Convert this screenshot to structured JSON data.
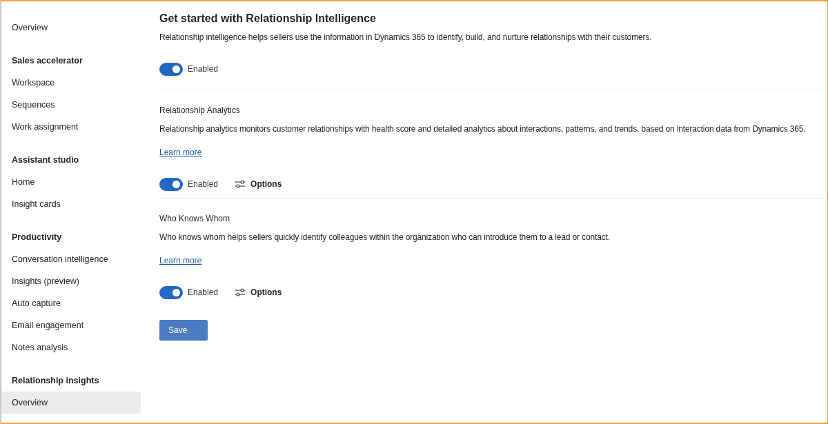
{
  "sidebar": {
    "groups": [
      {
        "items": [
          {
            "label": "Overview",
            "selected": false
          }
        ]
      },
      {
        "title": "Sales accelerator",
        "items": [
          {
            "label": "Workspace",
            "selected": false
          },
          {
            "label": "Sequences",
            "selected": false
          },
          {
            "label": "Work assignment",
            "selected": false
          }
        ]
      },
      {
        "title": "Assistant studio",
        "items": [
          {
            "label": "Home",
            "selected": false
          },
          {
            "label": "Insight cards",
            "selected": false
          }
        ]
      },
      {
        "title": "Productivity",
        "items": [
          {
            "label": "Conversation intelligence",
            "selected": false
          },
          {
            "label": "Insights (preview)",
            "selected": false
          },
          {
            "label": "Auto capture",
            "selected": false
          },
          {
            "label": "Email engagement",
            "selected": false
          },
          {
            "label": "Notes analysis",
            "selected": false
          }
        ]
      },
      {
        "title": "Relationship insights",
        "items": [
          {
            "label": "Overview",
            "selected": true
          }
        ]
      }
    ]
  },
  "main": {
    "title": "Get started with Relationship Intelligence",
    "description": "Relationship intelligence helps sellers use the information in Dynamics 365 to identify, build, and nurture relationships with their customers.",
    "toggle": {
      "label": "Enabled",
      "on": true
    },
    "sections": [
      {
        "title": "Relationship Analytics",
        "description": "Relationship analytics monitors customer relationships with health score and detailed analytics about interactions, patterns, and trends, based on interaction data from Dynamics 365.",
        "link": "Learn more",
        "toggle": {
          "label": "Enabled",
          "on": true
        },
        "options": "Options"
      },
      {
        "title": "Who Knows Whom",
        "description": "Who knows whom helps sellers quickly identify colleagues within the organization who can introduce them to a lead or contact.",
        "link": "Learn more",
        "toggle": {
          "label": "Enabled",
          "on": true
        },
        "options": "Options"
      }
    ],
    "save_button": "Save"
  }
}
